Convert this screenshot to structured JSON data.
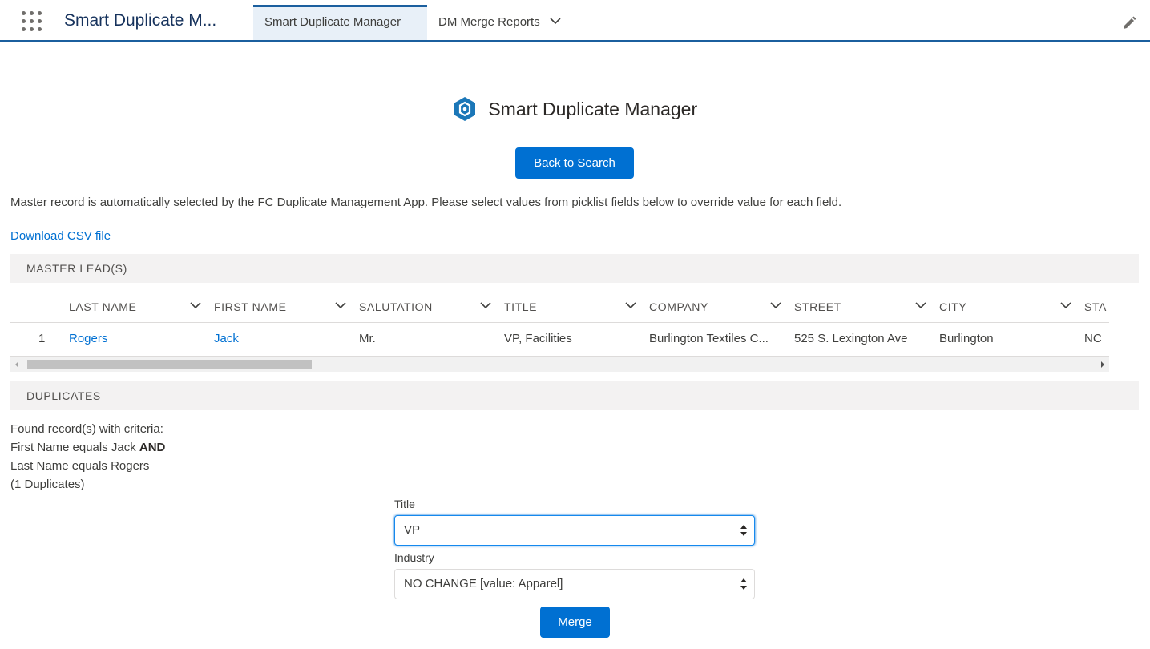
{
  "nav": {
    "app_name": "Smart Duplicate M...",
    "tabs": [
      {
        "label": "Smart Duplicate Manager",
        "active": true
      },
      {
        "label": "DM Merge Reports",
        "active": false
      }
    ]
  },
  "header": {
    "title": "Smart Duplicate Manager",
    "back_button": "Back to Search"
  },
  "instructions": "Master record is automatically selected by the FC Duplicate Management App. Please select values from picklist fields below to override value for each field.",
  "download_link": "Download CSV file",
  "master_section": {
    "heading": "MASTER LEAD(S)",
    "columns": [
      "LAST NAME",
      "FIRST NAME",
      "SALUTATION",
      "TITLE",
      "COMPANY",
      "STREET",
      "CITY",
      "STA"
    ],
    "rows": [
      {
        "index": "1",
        "last_name": "Rogers",
        "first_name": "Jack",
        "salutation": "Mr.",
        "title": "VP, Facilities",
        "company": "Burlington Textiles C...",
        "street": "525 S. Lexington Ave",
        "city": "Burlington",
        "state": "NC"
      }
    ]
  },
  "duplicates_section": {
    "heading": "DUPLICATES",
    "criteria_intro": "Found record(s) with criteria:",
    "criteria_line1": "First Name equals Jack ",
    "criteria_and": "AND",
    "criteria_line2": "Last Name equals Rogers",
    "count": "(1 Duplicates)"
  },
  "form": {
    "title_label": "Title",
    "title_value": "VP",
    "industry_label": "Industry",
    "industry_value": "NO CHANGE [value: Apparel]",
    "merge_button": "Merge"
  },
  "colors": {
    "brand": "#0070d2",
    "nav_border": "#1b5f9e",
    "logo": "#1b77b8"
  },
  "icons": [
    "app-launcher-icon",
    "edit-pencil-icon",
    "chevron-down-icon",
    "hexagon-logo-icon"
  ]
}
